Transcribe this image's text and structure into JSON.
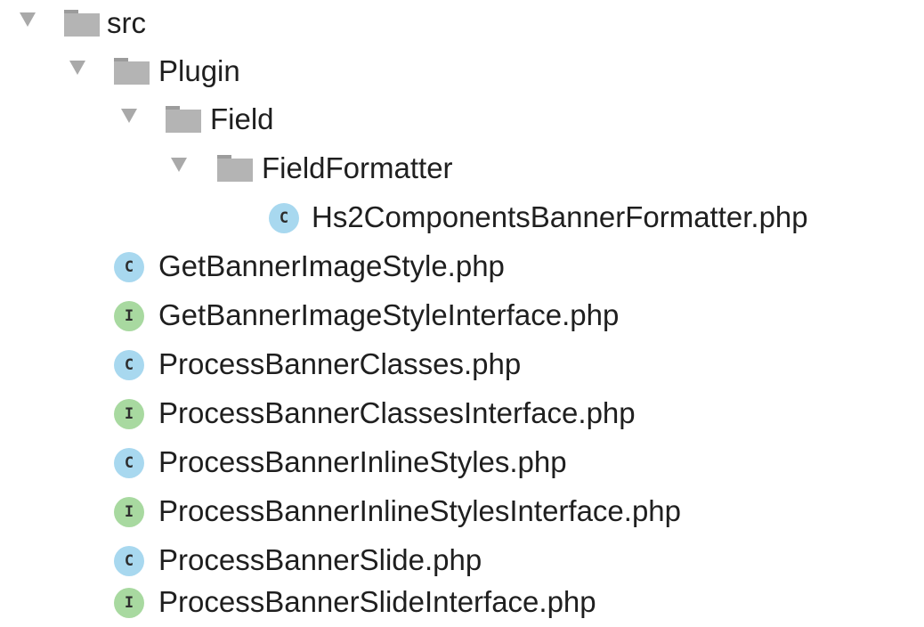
{
  "colors": {
    "arrow": "#a9a9a9",
    "folder": "#b4b4b4",
    "class_badge": "#a8d8ef",
    "interface_badge": "#a8d9a0"
  },
  "tree": {
    "folders": [
      {
        "name": "src",
        "icon": "folder-icon",
        "expanded": true
      },
      {
        "name": "Plugin",
        "icon": "folder-icon",
        "expanded": true
      },
      {
        "name": "Field",
        "icon": "folder-icon",
        "expanded": true
      },
      {
        "name": "FieldFormatter",
        "icon": "folder-icon",
        "expanded": true
      }
    ],
    "files": [
      {
        "name": "Hs2ComponentsBannerFormatter.php",
        "kind": "class",
        "badge": "C"
      },
      {
        "name": "GetBannerImageStyle.php",
        "kind": "class",
        "badge": "C"
      },
      {
        "name": "GetBannerImageStyleInterface.php",
        "kind": "interface",
        "badge": "I"
      },
      {
        "name": "ProcessBannerClasses.php",
        "kind": "class",
        "badge": "C"
      },
      {
        "name": "ProcessBannerClassesInterface.php",
        "kind": "interface",
        "badge": "I"
      },
      {
        "name": "ProcessBannerInlineStyles.php",
        "kind": "class",
        "badge": "C"
      },
      {
        "name": "ProcessBannerInlineStylesInterface.php",
        "kind": "interface",
        "badge": "I"
      },
      {
        "name": "ProcessBannerSlide.php",
        "kind": "class",
        "badge": "C"
      },
      {
        "name": "ProcessBannerSlideInterface.php",
        "kind": "interface",
        "badge": "I"
      }
    ]
  }
}
